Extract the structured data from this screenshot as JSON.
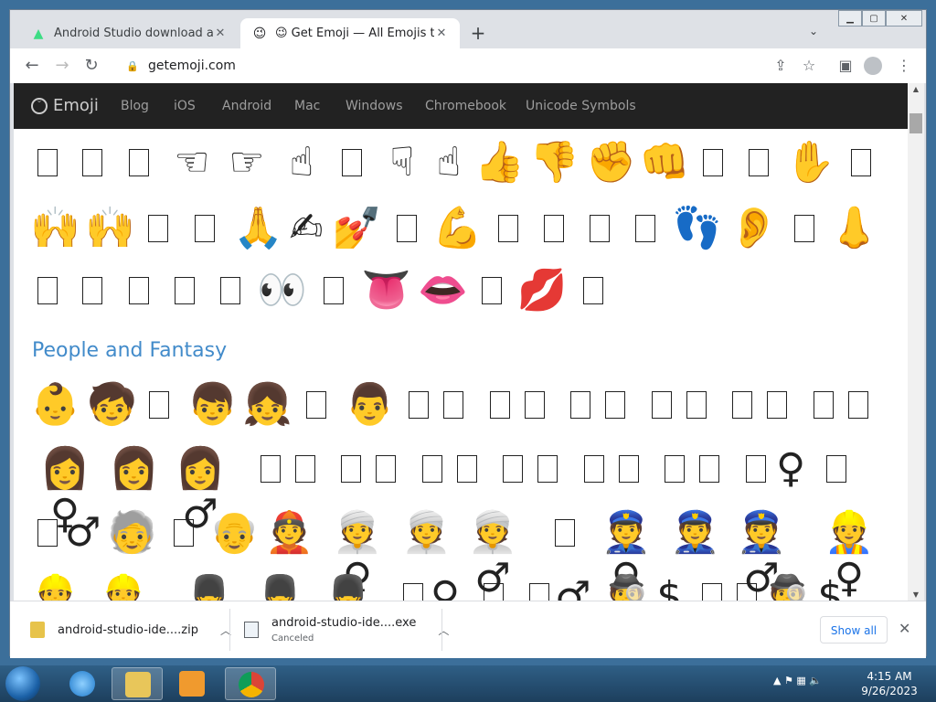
{
  "browser": {
    "tabs": [
      {
        "title": "Android Studio download archive"
      },
      {
        "title": "😉 Get Emoji — All Emojis to ✂️ Copy and Paste 👍"
      }
    ],
    "url": "getemoji.com"
  },
  "site": {
    "brand": "Emoji",
    "nav": [
      "Blog",
      "iOS",
      "Android",
      "Mac",
      "Windows",
      "Chromebook",
      "Unicode Symbols"
    ],
    "section_title": "People and Fantasy"
  },
  "downloads": {
    "items": [
      {
        "name": "android-studio-ide....zip",
        "status": ""
      },
      {
        "name": "android-studio-ide....exe",
        "status": "Canceled"
      }
    ],
    "show_all": "Show all"
  },
  "taskbar": {
    "time": "4:15 AM",
    "date": "9/26/2023"
  }
}
